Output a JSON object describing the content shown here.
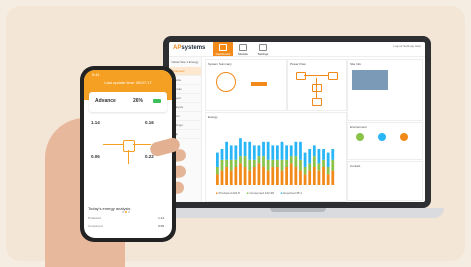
{
  "laptop": {
    "logo": {
      "brand": "AP",
      "rest": "systems"
    },
    "nav": [
      "Dashboard",
      "Module",
      "Settings"
    ],
    "topright": "Logout  Settings  Help",
    "sidebar": {
      "title": "Yellow Site 1 Energy",
      "items": [
        "Overview",
        "Device",
        "Module",
        "Report",
        "Analysis",
        "Alarm",
        "Settings",
        "Help"
      ]
    },
    "panels": {
      "summary_title": "System Summary",
      "flow_title": "Power Flow",
      "info_title": "Site Info",
      "chart_title": "Energy",
      "env_title": "Environment",
      "contact_title": "Contact"
    },
    "legend": [
      "Produced",
      "Consumed",
      "Exported"
    ],
    "legend_values": [
      "222.8",
      "142.38",
      "35.1"
    ]
  },
  "phone": {
    "time": "9:41",
    "title": "Last update time: 08:07:17",
    "mode": "Advance",
    "percent": "26%",
    "nodes": {
      "solar": "1.14",
      "grid": "0.06",
      "home": "0.16",
      "battery": "0.22"
    },
    "analysis_title": "Today's energy analysis",
    "rows": [
      {
        "label": "Produced",
        "value": "1.14"
      },
      {
        "label": "Consumed",
        "value": "0.05"
      }
    ]
  },
  "chart_data": {
    "type": "bar",
    "series": [
      {
        "values": [
          3,
          4,
          5,
          4,
          5,
          6,
          5,
          4,
          5,
          6,
          5,
          4,
          5,
          5,
          4,
          5,
          6,
          5,
          4,
          3,
          4,
          5,
          4,
          5,
          3,
          4
        ]
      },
      {
        "values": [
          2,
          3,
          2,
          3,
          2,
          2,
          3,
          3,
          2,
          2,
          3,
          3,
          2,
          2,
          3,
          2,
          2,
          3,
          3,
          2,
          2,
          3,
          2,
          2,
          2,
          3
        ]
      },
      {
        "values": [
          4,
          3,
          5,
          4,
          4,
          5,
          4,
          5,
          4,
          3,
          4,
          5,
          4,
          4,
          5,
          4,
          3,
          4,
          5,
          4,
          4,
          3,
          4,
          3,
          4,
          3
        ]
      }
    ],
    "colors": [
      "#f28a1a",
      "#8bc34a",
      "#29b6f6"
    ]
  }
}
